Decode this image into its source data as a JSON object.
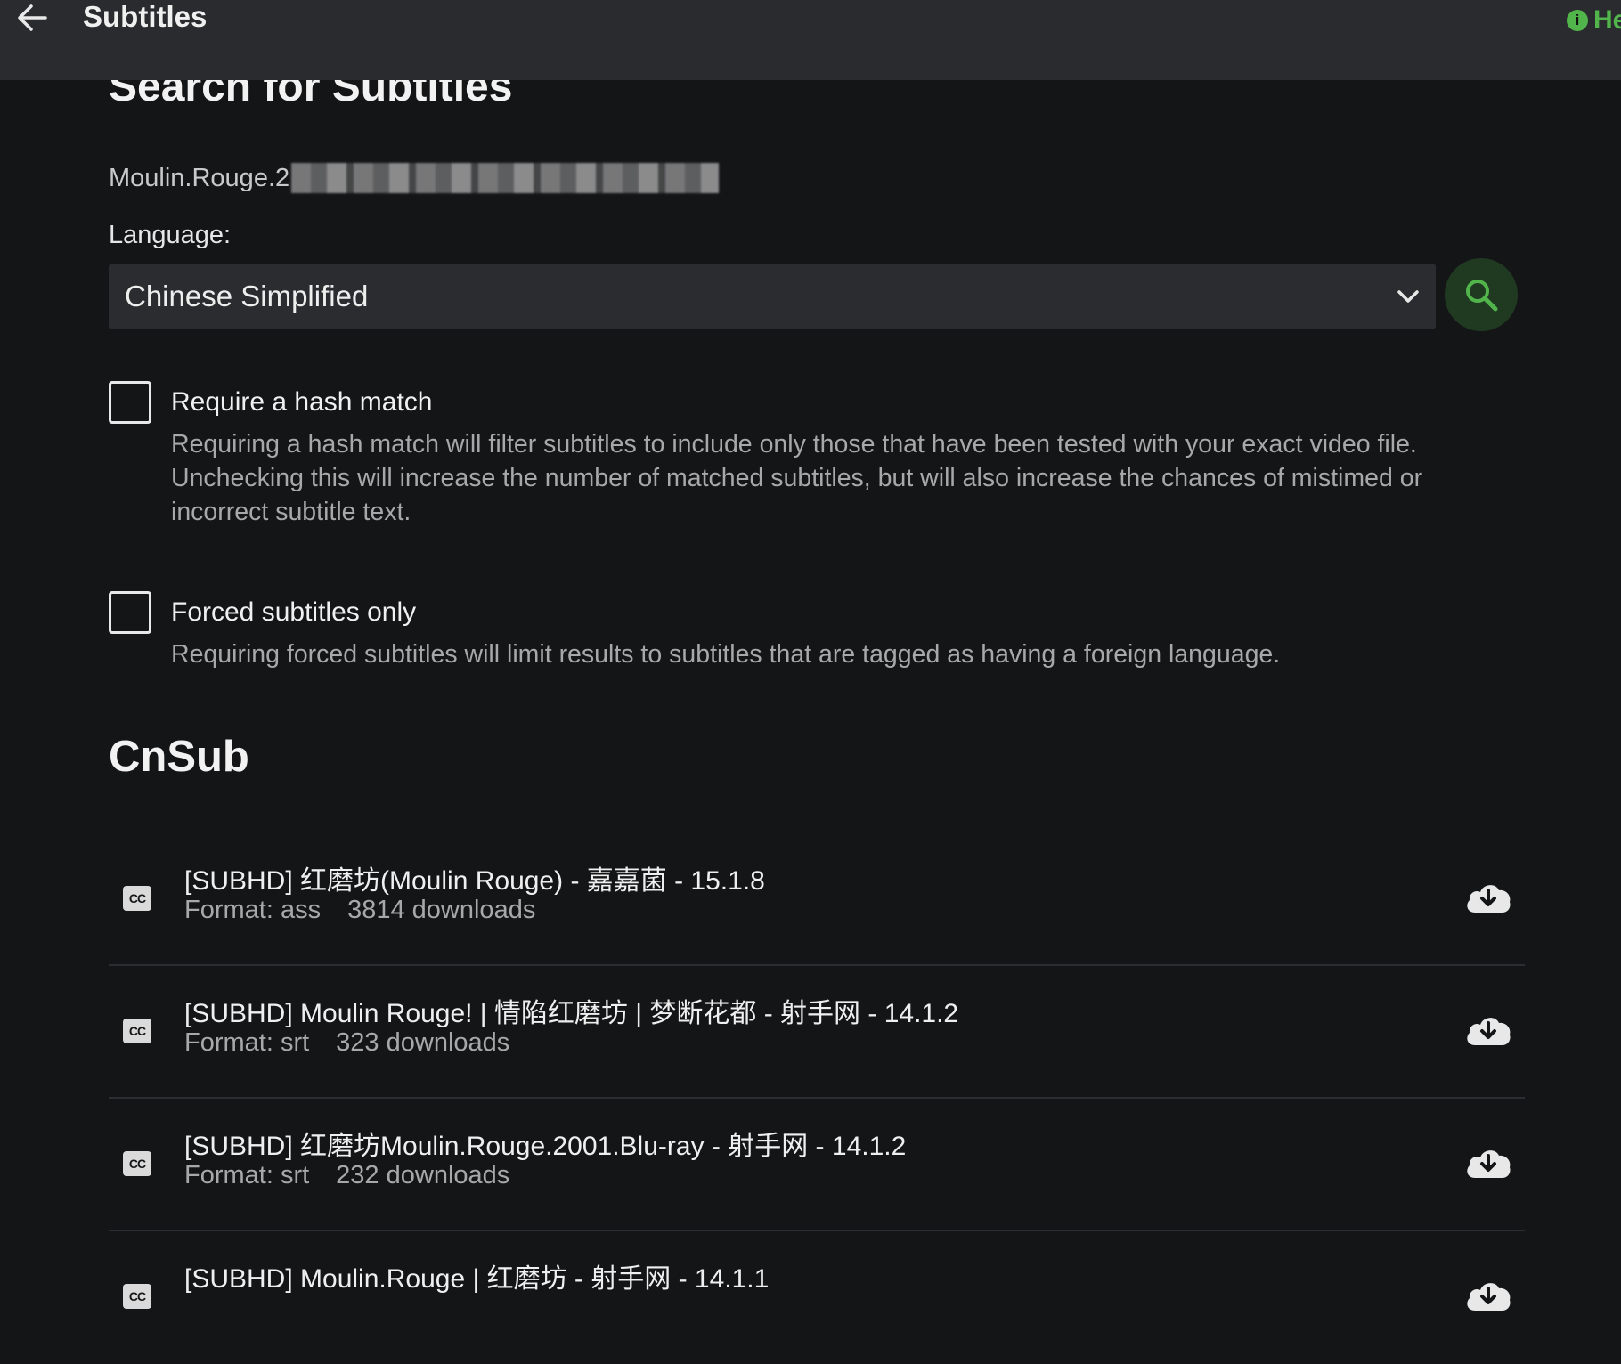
{
  "header": {
    "title": "Subtitles",
    "help_label": "He"
  },
  "search": {
    "heading": "Search for Subtitles",
    "file_name": "Moulin.Rouge.2",
    "language_label": "Language:",
    "language_value": "Chinese Simplified"
  },
  "options": {
    "hash_label": "Require a hash match",
    "hash_desc": "Requiring a hash match will filter subtitles to include only those that have been tested with your exact video file. Unchecking this will increase the number of matched subtitles, but will also increase the chances of mistimed or incorrect subtitle text.",
    "forced_label": "Forced subtitles only",
    "forced_desc": "Requiring forced subtitles will limit results to subtitles that are tagged as having a foreign language."
  },
  "provider": "CnSub",
  "results": [
    {
      "title": "[SUBHD] 红磨坊(Moulin Rouge) - 嘉嘉菌 - 15.1.8",
      "format": "Format: ass",
      "downloads": "3814 downloads"
    },
    {
      "title": "[SUBHD] Moulin Rouge! | 情陷红磨坊 | 梦断花都 - 射手网 - 14.1.2",
      "format": "Format: srt",
      "downloads": "323 downloads"
    },
    {
      "title": "[SUBHD] 红磨坊Moulin.Rouge.2001.Blu-ray - 射手网 - 14.1.2",
      "format": "Format: srt",
      "downloads": "232 downloads"
    },
    {
      "title": "[SUBHD] Moulin.Rouge | 红磨坊 - 射手网 - 14.1.1",
      "format": "",
      "downloads": ""
    }
  ],
  "icons": {
    "cc": "CC",
    "back": "arrow-left-icon",
    "search": "search-icon",
    "download": "cloud-download-icon",
    "info": "info-icon"
  },
  "colors": {
    "accent": "#52b54b",
    "background": "#141517",
    "header": "#2a2b2e"
  }
}
